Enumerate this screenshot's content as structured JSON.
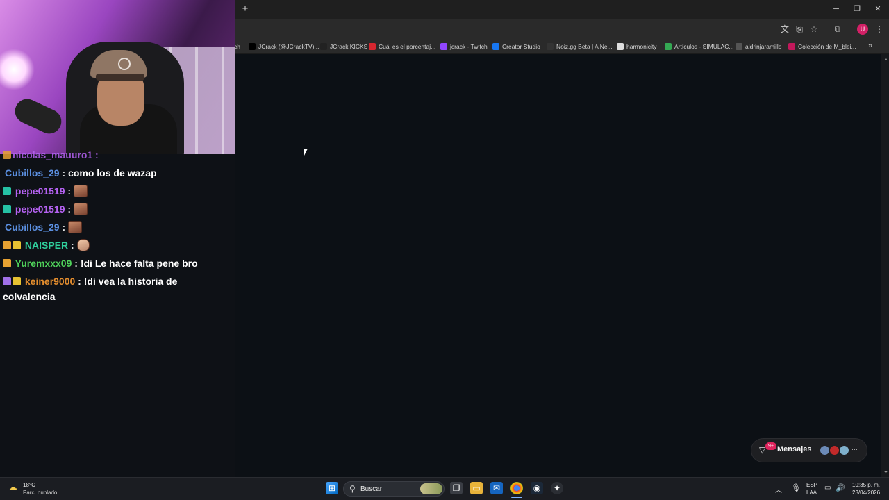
{
  "browser": {
    "new_tab_label": "+",
    "window_controls": {
      "minimize": "─",
      "restore": "❐",
      "close": "✕"
    },
    "bookmarks": [
      {
        "label": "ch",
        "icon": "blank-icon",
        "color": "#2a2a2a"
      },
      {
        "label": "JCrack (@JCrackTV)...",
        "icon": "x-logo-icon",
        "color": "#000000"
      },
      {
        "label": "JCrack KICKS",
        "icon": "kick-icon",
        "color": "#222222"
      },
      {
        "label": "Cuál es el porcentaj...",
        "icon": "s-icon",
        "color": "#d6262f"
      },
      {
        "label": "jcrack - Twitch",
        "icon": "twitch-icon",
        "color": "#9146ff"
      },
      {
        "label": "Creator Studio",
        "icon": "facebook-icon",
        "color": "#1877f2"
      },
      {
        "label": "Noiz.gg Beta | A Ne...",
        "icon": "noiz-icon",
        "color": "#333333"
      },
      {
        "label": "harmonicity",
        "icon": "harmonicity-icon",
        "color": "#dddddd"
      },
      {
        "label": "Artículos - SIMULAC...",
        "icon": "drive-icon",
        "color": "#34a853"
      },
      {
        "label": "aldrinjaramillo",
        "icon": "globe-icon",
        "color": "#555555"
      },
      {
        "label": "Colección de M_blei...",
        "icon": "collection-icon",
        "color": "#c2185b"
      }
    ],
    "more_bookmarks": "»"
  },
  "chat": {
    "partial_top": "nicolas_mauuro1 :",
    "messages": [
      {
        "user": "Cubillos_29",
        "color": "#5b8fe0",
        "badges": [],
        "text": "como los de wazap",
        "emote": null
      },
      {
        "user": "pepe01519",
        "color": "#b562f2",
        "badges": [
          "#25c1a4"
        ],
        "text": "",
        "emote": "face"
      },
      {
        "user": "pepe01519",
        "color": "#b562f2",
        "badges": [
          "#25c1a4"
        ],
        "text": "",
        "emote": "face"
      },
      {
        "user": "Cubillos_29",
        "color": "#5b8fe0",
        "badges": [],
        "text": "",
        "emote": "face"
      },
      {
        "user": "NAISPER",
        "color": "#2fcf9c",
        "badges": [
          "#e7a232",
          "#e7c232"
        ],
        "text": "",
        "emote": "hand"
      },
      {
        "user": "Yuremxxx09",
        "color": "#4fd15a",
        "badges": [
          "#e7a232"
        ],
        "text": "!di Le hace falta pene bro",
        "emote": null
      },
      {
        "user": "keiner9000",
        "color": "#e38d2e",
        "badges": [
          "#a070e8",
          "#e7c232"
        ],
        "text": "!di vea la historia de",
        "text2": "colvalencia",
        "emote": null
      }
    ]
  },
  "mensajes": {
    "label": "Mensajes",
    "count": "9+"
  },
  "taskbar": {
    "weather_temp": "18°C",
    "weather_desc": "Parc. nublado",
    "search_placeholder": "Buscar",
    "lang_1": "ESP",
    "lang_2": "LAA",
    "time": "10:35 p. m.",
    "date": "23/04/2026"
  }
}
